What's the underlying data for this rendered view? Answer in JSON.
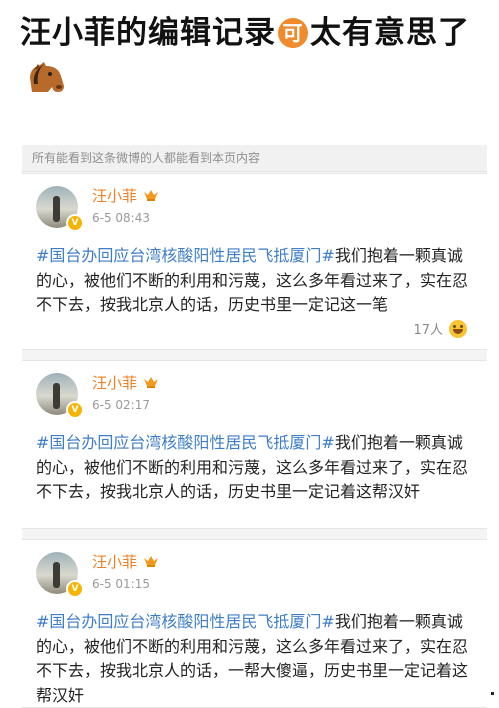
{
  "headline": {
    "part1": "汪小菲的编辑记录",
    "emoji_ke": "可",
    "part2": "太有意思了",
    "horse_icon": "horse-face-emoji"
  },
  "privacy_notice": "所有能看到这条微博的人都能看到本页内容",
  "posts": [
    {
      "username": "汪小菲",
      "time": "6-5 08:43",
      "hashtag": "#国台办回应台湾核酸阳性居民飞抵厦门#",
      "body": "我们抱着一颗真诚的心，被他们不断的利用和污蔑，这么多年看过来了，实在忍不下去，按我北京人的话，历史书里一定记这一笔",
      "likes": "17人"
    },
    {
      "username": "汪小菲",
      "time": "6-5 02:17",
      "hashtag": "#国台办回应台湾核酸阳性居民飞抵厦门#",
      "body": "我们抱着一颗真诚的心，被他们不断的利用和污蔑，这么多年看过来了，实在忍不下去，按我北京人的话，历史书里一定记着这帮汉奸"
    },
    {
      "username": "汪小菲",
      "time": "6-5 01:15",
      "hashtag": "#国台办回应台湾核酸阳性居民飞抵厦门#",
      "body": "我们抱着一颗真诚的心，被他们不断的利用和污蔑，这么多年看过来了，实在忍不下去，按我北京人的话，一帮大傻逼，历史书里一定记着这帮汉奸"
    }
  ],
  "colors": {
    "username": "#f07f23",
    "hashtag": "#3e7ec8",
    "verified_badge": "#f5b400"
  }
}
